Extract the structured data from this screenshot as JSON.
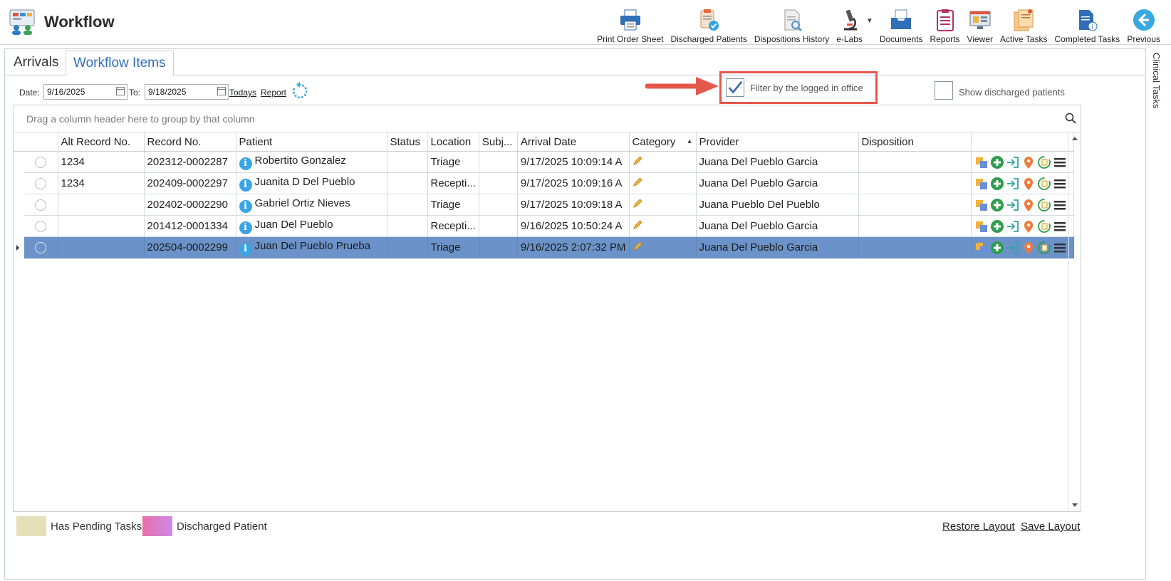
{
  "app": {
    "title": "Workflow"
  },
  "toolbar": {
    "buttons": [
      {
        "label": "Print Order Sheet",
        "icon": "printer-icon"
      },
      {
        "label": "Discharged Patients",
        "icon": "discharged-patients-icon"
      },
      {
        "label": "Dispositions History",
        "icon": "dispositions-history-icon"
      },
      {
        "label": "e-Labs",
        "icon": "microscope-icon"
      },
      {
        "label": "Documents",
        "icon": "documents-tray-icon"
      },
      {
        "label": "Reports",
        "icon": "reports-clipboard-icon"
      },
      {
        "label": "Viewer",
        "icon": "viewer-monitor-icon"
      },
      {
        "label": "Active Tasks",
        "icon": "active-tasks-icon"
      },
      {
        "label": "Completed Tasks",
        "icon": "completed-tasks-icon"
      },
      {
        "label": "Previous",
        "icon": "previous-arrow-icon"
      }
    ]
  },
  "tabs": {
    "arrivals": "Arrivals",
    "workflow_items": "Workflow Items"
  },
  "filters": {
    "date_label": "Date:",
    "date_from": "9/16/2025",
    "to_label": "To:",
    "date_to": "9/18/2025",
    "todays": "Todays",
    "report": "Report",
    "filter_office_label": "Filter by the logged in office",
    "filter_office_checked": true,
    "show_discharged_label": "Show discharged patients",
    "show_discharged_checked": false
  },
  "grid": {
    "group_hint": "Drag a column header here to group by that column",
    "columns": [
      "",
      "Alt Record No.",
      "Record No.",
      "Patient",
      "Status",
      "Location",
      "Subj...",
      "Arrival Date",
      "Category",
      "Provider",
      "Disposition",
      ""
    ],
    "rows": [
      {
        "alt": "1234",
        "record": "202312-0002287",
        "patient": "Robertito Gonzalez",
        "status": "",
        "location": "Triage",
        "subj": "",
        "arrival": "9/17/2025 10:09:14 A",
        "provider": "Juana Del Pueblo Garcia",
        "disposition": ""
      },
      {
        "alt": "1234",
        "record": "202409-0002297",
        "patient": "Juanita D Del Pueblo",
        "status": "",
        "location": "Recepti...",
        "subj": "",
        "arrival": "9/17/2025 10:09:16 A",
        "provider": "Juana Del Pueblo Garcia",
        "disposition": ""
      },
      {
        "alt": "",
        "record": "202402-0002290",
        "patient": "Gabriel Ortiz Nieves",
        "status": "",
        "location": "Triage",
        "subj": "",
        "arrival": "9/17/2025 10:09:18 A",
        "provider": "Juana Pueblo Del Pueblo",
        "disposition": ""
      },
      {
        "alt": "",
        "record": "201412-0001334",
        "patient": "Juan Del Pueblo",
        "status": "",
        "location": "Recepti...",
        "subj": "",
        "arrival": "9/16/2025 10:50:24 A",
        "provider": "Juana Del Pueblo Garcia",
        "disposition": ""
      },
      {
        "alt": "",
        "record": "202504-0002299",
        "patient": "Juan Del Pueblo Prueba",
        "status": "",
        "location": "Triage",
        "subj": "",
        "arrival": "9/16/2025 2:07:32 PM",
        "provider": "Juana Del Pueblo Garcia",
        "disposition": ""
      }
    ],
    "selected_row": 4,
    "row_action_icons": [
      "assign-icon",
      "add-icon",
      "check-in-icon",
      "location-pin-icon",
      "refresh-list-icon",
      "menu-icon"
    ]
  },
  "legend": {
    "pending_label": "Has Pending Tasks",
    "pending_color": "#e6e0b8",
    "discharged_label": "Discharged Patient",
    "discharged_color": "#ea6fa8"
  },
  "footer": {
    "restore_layout": "Restore Layout",
    "save_layout": "Save Layout"
  },
  "right_rail": {
    "label": "Clinical Tasks"
  },
  "colors": {
    "selected_row": "#6b93c9",
    "accent_tab": "#2f6eb8",
    "highlight_box": "#e6574b"
  }
}
